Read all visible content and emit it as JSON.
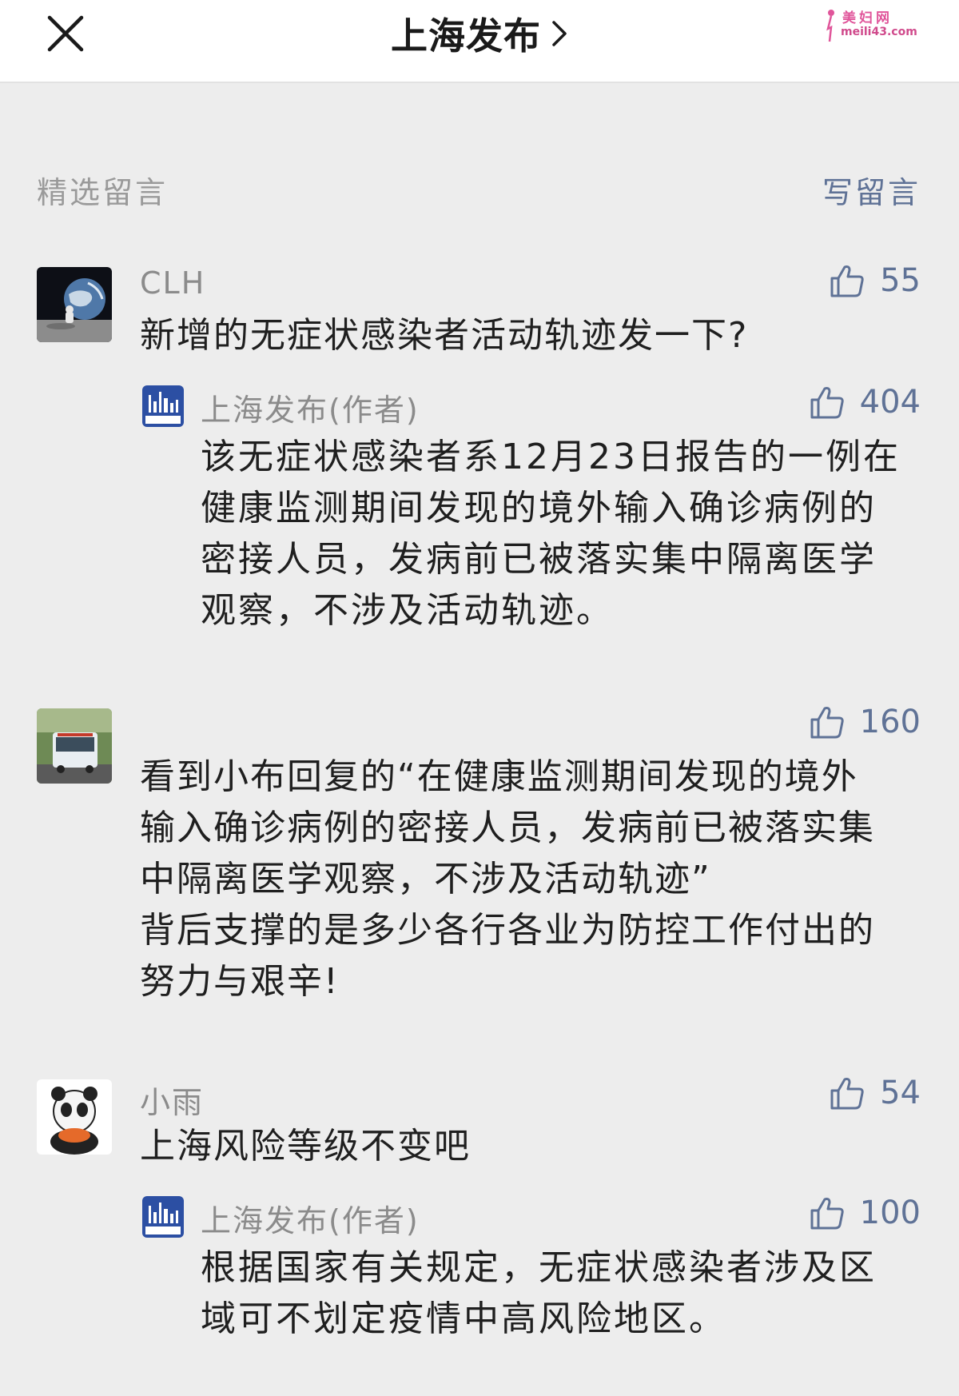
{
  "header": {
    "title": "上海发布",
    "watermark_top": "美妇网",
    "watermark_bottom": "meili43.com"
  },
  "section": {
    "label": "精选留言",
    "write_label": "写留言"
  },
  "comments": [
    {
      "username": "CLH",
      "likes": "55",
      "text": "新增的无症状感染者活动轨迹发一下?",
      "reply": {
        "author": "上海发布(作者)",
        "likes": "404",
        "lines": [
          "该无症状感染者系12月23日报告的一例在",
          "健康监测期间发现的境外输入确诊病例的",
          "密接人员，发病前已被落实集中隔离医学",
          "观察，不涉及活动轨迹。"
        ]
      }
    },
    {
      "username": "",
      "likes": "160",
      "lines": [
        "看到小布回复的“在健康监测期间发现的境外",
        "输入确诊病例的密接人员，发病前已被落实集",
        "中隔离医学观察，不涉及活动轨迹”",
        "背后支撑的是多少各行各业为防控工作付出的",
        "努力与艰辛!"
      ]
    },
    {
      "username": "小雨",
      "likes": "54",
      "text": "上海风险等级不变吧",
      "reply": {
        "author": "上海发布(作者)",
        "likes": "100",
        "lines": [
          "根据国家有关规定，无症状感染者涉及区",
          "域可不划定疫情中高风险地区。"
        ]
      }
    }
  ],
  "colors": {
    "background": "#ededed",
    "link": "#5f7296",
    "muted": "#8b8b8b"
  },
  "icons": [
    "close-icon",
    "chevron-right-icon",
    "thumbs-up-icon"
  ]
}
